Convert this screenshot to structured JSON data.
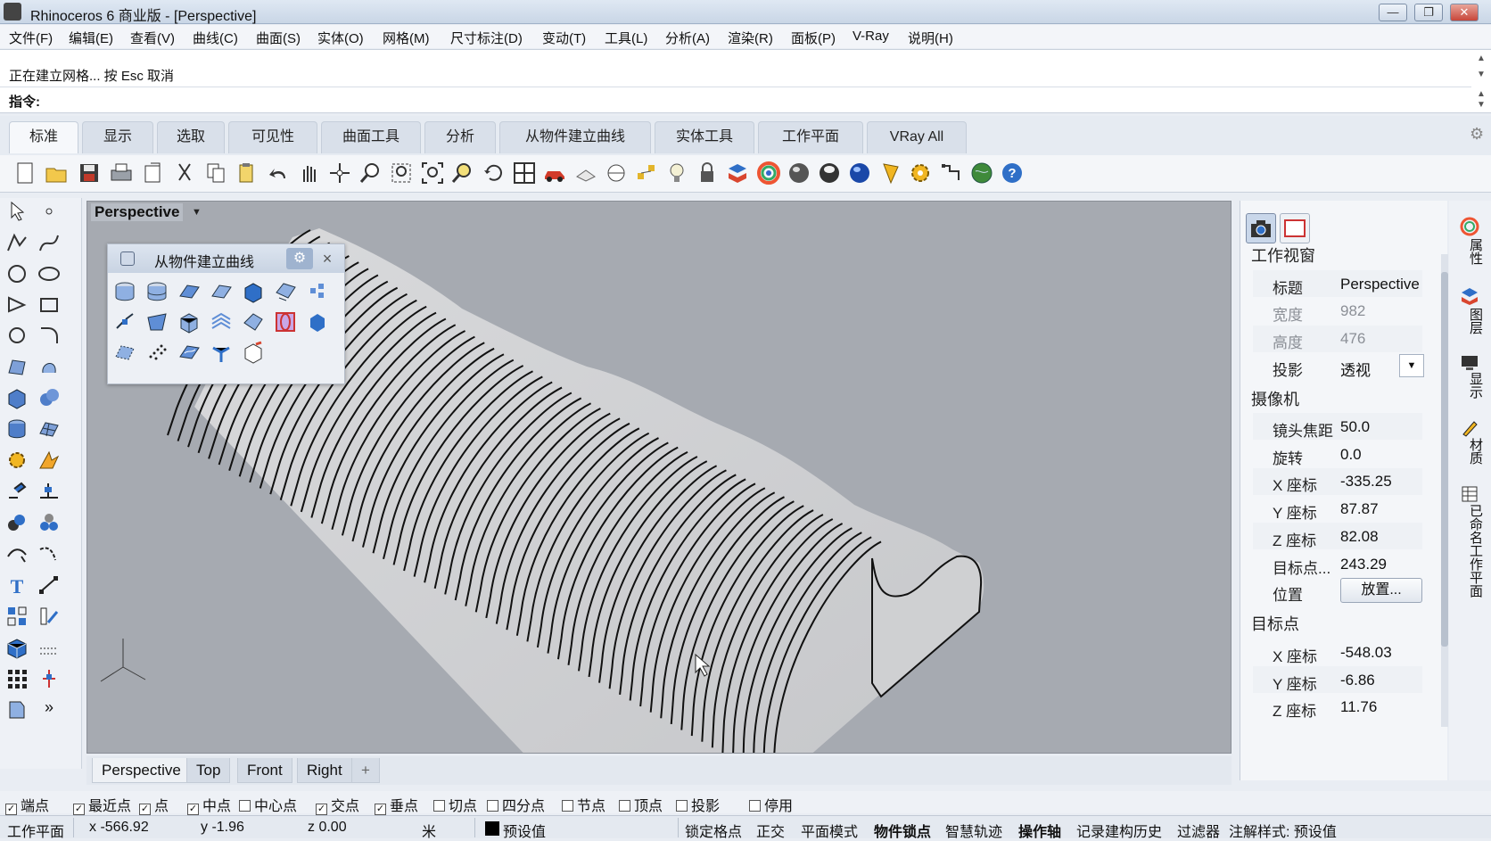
{
  "window": {
    "title": "Rhinoceros 6 商业版 - [Perspective]",
    "controls": [
      "—",
      "❐",
      "✕"
    ]
  },
  "menu": [
    "文件(F)",
    "编辑(E)",
    "查看(V)",
    "曲线(C)",
    "曲面(S)",
    "实体(O)",
    "网格(M)",
    "尺寸标注(D)",
    "变动(T)",
    "工具(L)",
    "分析(A)",
    "渲染(R)",
    "面板(P)",
    "V-Ray",
    "说明(H)"
  ],
  "command": {
    "history": "正在建立网格... 按 Esc 取消",
    "prompt": "指令:",
    "value": ""
  },
  "tabs": [
    "标准",
    "显示",
    "选取",
    "可见性",
    "曲面工具",
    "分析",
    "从物件建立曲线",
    "实体工具",
    "工作平面",
    "VRay All"
  ],
  "toolbar_icons": [
    "new-file-icon",
    "open-icon",
    "save-icon",
    "print-icon",
    "import-icon",
    "cut-icon",
    "copy-icon",
    "paste-icon",
    "undo-icon",
    "pan-icon",
    "rotate-view-icon",
    "zoom-icon",
    "zoom-window-icon",
    "zoom-extents-icon",
    "zoom-selected-icon",
    "undo-view-icon",
    "four-viewports-icon",
    "car-icon",
    "hide-icon",
    "lens-icon",
    "points-icon",
    "light-icon",
    "lock-icon",
    "layer-icon",
    "color-icon",
    "sphere-icon",
    "shaded-sphere-icon",
    "render-sphere-icon",
    "vray-render-icon",
    "vray-settings-icon",
    "vray-frame-icon",
    "vray-globe-icon",
    "help-icon"
  ],
  "viewport": {
    "label": "Perspective",
    "tabs": [
      "Perspective",
      "Top",
      "Front",
      "Right",
      "+"
    ]
  },
  "floating_toolbar": {
    "title": "从物件建立曲线",
    "gear": "⚙",
    "close": "×"
  },
  "panel": {
    "section_viewport": "工作视窗",
    "rows_viewport": [
      {
        "label": "标题",
        "value": "Perspective",
        "dim": false
      },
      {
        "label": "宽度",
        "value": "982",
        "dim": true
      },
      {
        "label": "高度",
        "value": "476",
        "dim": true
      },
      {
        "label": "投影",
        "value": "透视",
        "dim": false
      }
    ],
    "section_camera": "摄像机",
    "rows_camera": [
      {
        "label": "镜头焦距",
        "value": "50.0"
      },
      {
        "label": "旋转",
        "value": "0.0"
      },
      {
        "label": "X 座标",
        "value": "-335.25"
      },
      {
        "label": "Y 座标",
        "value": "87.87"
      },
      {
        "label": "Z 座标",
        "value": "82.08"
      },
      {
        "label": "目标点...",
        "value": "243.29"
      },
      {
        "label": "位置",
        "value": "放置..."
      }
    ],
    "section_target": "目标点",
    "rows_target": [
      {
        "label": "X 座标",
        "value": "-548.03"
      },
      {
        "label": "Y 座标",
        "value": "-6.86"
      },
      {
        "label": "Z 座标",
        "value": "11.76"
      }
    ]
  },
  "right_sidebar": [
    "属性",
    "图层",
    "显示",
    "材质",
    "已命名工作平面"
  ],
  "osnap": [
    {
      "label": "端点",
      "checked": true
    },
    {
      "label": "最近点",
      "checked": true
    },
    {
      "label": "点",
      "checked": true
    },
    {
      "label": "中点",
      "checked": true
    },
    {
      "label": "中心点",
      "checked": false
    },
    {
      "label": "交点",
      "checked": true
    },
    {
      "label": "垂点",
      "checked": true
    },
    {
      "label": "切点",
      "checked": false
    },
    {
      "label": "四分点",
      "checked": false
    },
    {
      "label": "节点",
      "checked": false
    },
    {
      "label": "顶点",
      "checked": false
    },
    {
      "label": "投影",
      "checked": false
    },
    {
      "label": "停用",
      "checked": false
    }
  ],
  "status": {
    "cplane": "工作平面",
    "x": "x -566.92",
    "y": "y -1.96",
    "z": "z 0.00",
    "unit": "米",
    "layer": "预设值",
    "items": [
      "锁定格点",
      "正交",
      "平面模式",
      "物件锁点",
      "智慧轨迹",
      "操作轴",
      "记录建构历史",
      "过滤器",
      "注解样式: 预设值"
    ]
  },
  "colors": {
    "viewport_bg": "#a6aab1",
    "model_fill": "#d6d7d9",
    "accent": "#2f6fc7"
  }
}
